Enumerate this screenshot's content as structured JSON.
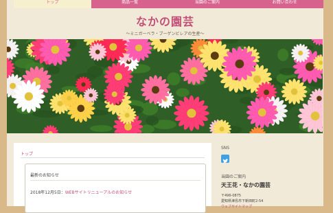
{
  "nav": {
    "items": [
      "トップ",
      "商品一覧",
      "当園のご案内",
      "お問い合わせ"
    ]
  },
  "header": {
    "title": "なかの園芸",
    "tagline": "〜ミニガーベラ・ブーゲンビレアの生産〜"
  },
  "hero": {
    "icon": "gerbera-flowers-photo"
  },
  "main": {
    "breadcrumb": "トップ",
    "news": {
      "heading": "最新のお知らせ",
      "items": [
        {
          "date": "2018年12月5日：",
          "title": "WEBサイトリニューアルのお知らせ"
        }
      ]
    }
  },
  "sidebar": {
    "sns_label": "SNS",
    "twitter_icon": "twitter-icon",
    "guide_label": "当園のご案内",
    "company_name": "天王花・なかの園芸",
    "postal": "〒496-0875",
    "address": "愛知県津島市下新田町2-54",
    "map_link": "ウェブサイトマップ"
  },
  "colors": {
    "accent": "#d7628d",
    "nav_active_bg": "#f6f0cf",
    "page_bg": "#f2ead8",
    "outer_bg": "#d9b98a"
  }
}
